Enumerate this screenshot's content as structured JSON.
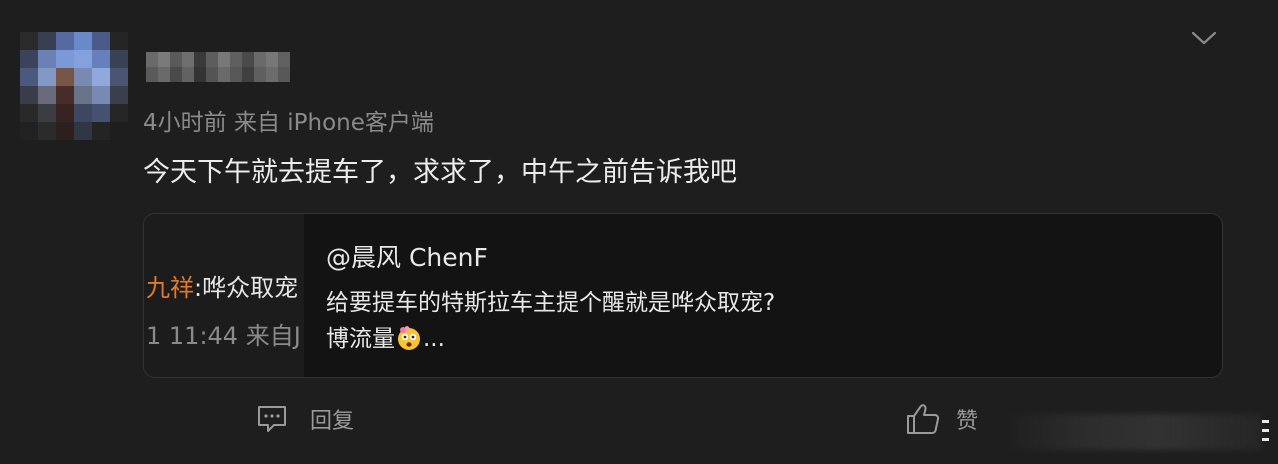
{
  "comment": {
    "meta": "4小时前  来自 iPhone客户端",
    "text": "今天下午就去提车了，求求了，中午之前告诉我吧",
    "quoted_post": {
      "thumbnail": {
        "name_fragment": "九祥",
        "text_fragment": ":哗众取宠",
        "time_fragment": "1 11:44  来自J"
      },
      "author": "@晨风 ChenF",
      "line1": "给要提车的特斯拉车主提个醒就是哗众取宠?",
      "line2_before_emoji": "博流量",
      "emoji": "astonished-face-emoji",
      "line2_after_emoji": "..."
    },
    "actions": {
      "reply_label": "回复",
      "like_label": "赞"
    }
  },
  "colors": {
    "background": "#1e1e1e",
    "card_background": "#131313",
    "name_highlight": "#e07a2f",
    "secondary_text": "#8a8a8a"
  },
  "icons": {
    "collapse": "chevron-down-icon",
    "reply": "comment-icon",
    "like": "thumbs-up-icon"
  }
}
